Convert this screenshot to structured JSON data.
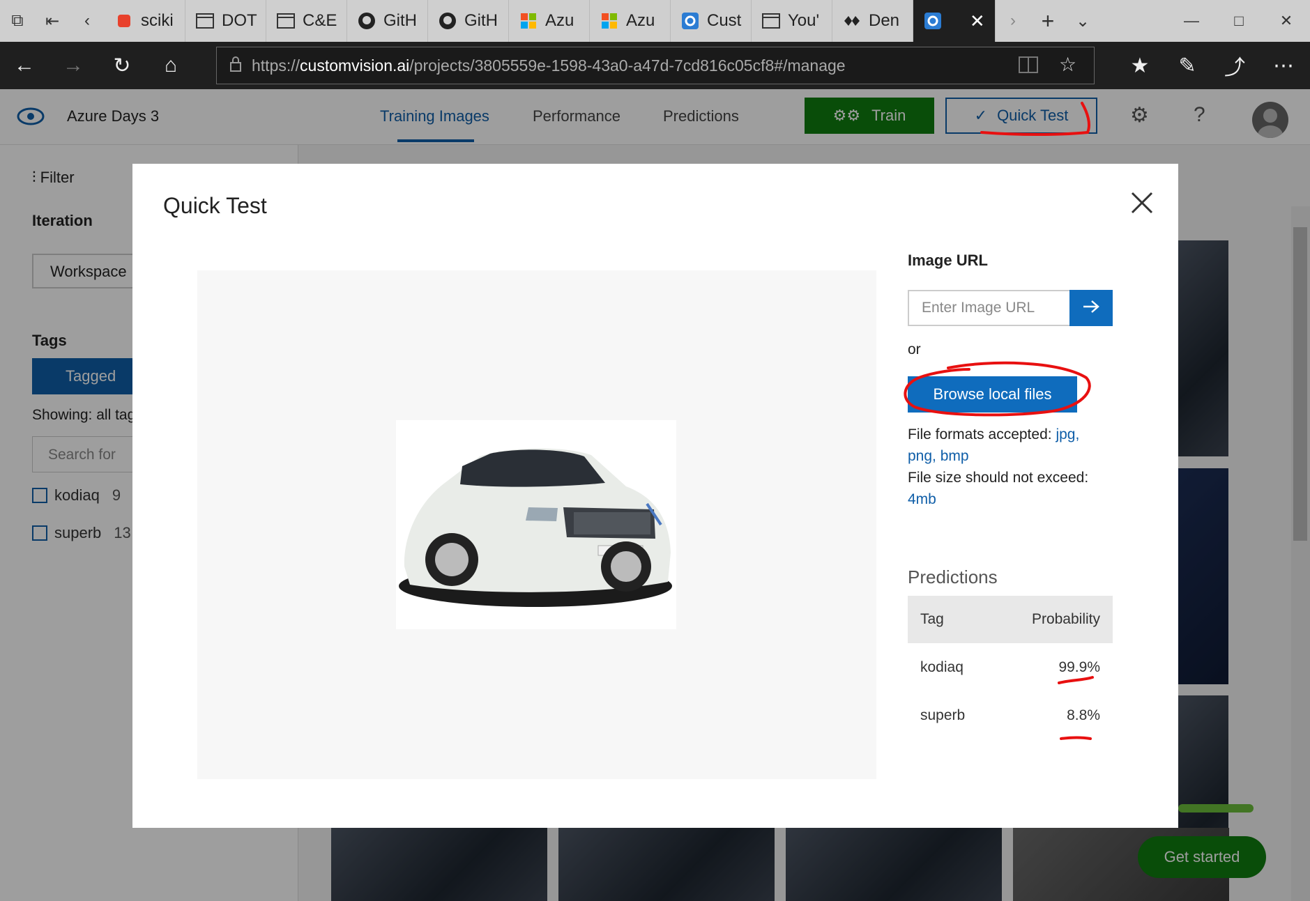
{
  "browser": {
    "tabs": [
      {
        "label": "sciki",
        "icon": "scikit-icon"
      },
      {
        "label": "DOT",
        "icon": "page-icon"
      },
      {
        "label": "C&E",
        "icon": "page-icon"
      },
      {
        "label": "GitH",
        "icon": "github-icon"
      },
      {
        "label": "GitH",
        "icon": "github-icon"
      },
      {
        "label": "Azu",
        "icon": "microsoft-icon"
      },
      {
        "label": "Azu",
        "icon": "microsoft-icon"
      },
      {
        "label": "Cust",
        "icon": "customvision-icon"
      },
      {
        "label": "You'",
        "icon": "page-icon"
      },
      {
        "label": "Den",
        "icon": "demo-icon"
      }
    ],
    "url_prefix": "https://",
    "url_domain": "customvision.ai",
    "url_path": "/projects/3805559e-1598-43a0-a47d-7cd816c05cf8#/manage"
  },
  "app": {
    "project_title": "Azure Days 3",
    "tabs": [
      "Training Images",
      "Performance",
      "Predictions"
    ],
    "train_label": "Train",
    "quick_test_label": "Quick Test",
    "accent": "#0f5ea8",
    "green": "#107c10"
  },
  "sidebar": {
    "filter_label": "Filter",
    "iteration_label": "Iteration",
    "workspace_label": "Workspace",
    "tags_label": "Tags",
    "tagged_label": "Tagged",
    "showing_label": "Showing: all tag",
    "search_placeholder": "Search for",
    "tags": [
      {
        "name": "kodiaq",
        "count": "9"
      },
      {
        "name": "superb",
        "count": "13"
      }
    ]
  },
  "get_started_label": "Get started",
  "modal": {
    "title": "Quick Test",
    "image_url_label": "Image URL",
    "image_url_placeholder": "Enter Image URL",
    "or_label": "or",
    "browse_label": "Browse local files",
    "formats_prefix": "File formats accepted:",
    "formats": [
      "jpg,",
      "png,",
      "bmp"
    ],
    "size_prefix": "File size should not exceed:",
    "size_value": "4mb",
    "predictions_title": "Predictions",
    "table_headers": [
      "Tag",
      "Probability"
    ],
    "predictions": [
      {
        "tag": "kodiaq",
        "probability": "99.9%"
      },
      {
        "tag": "superb",
        "probability": "8.8%"
      }
    ]
  }
}
